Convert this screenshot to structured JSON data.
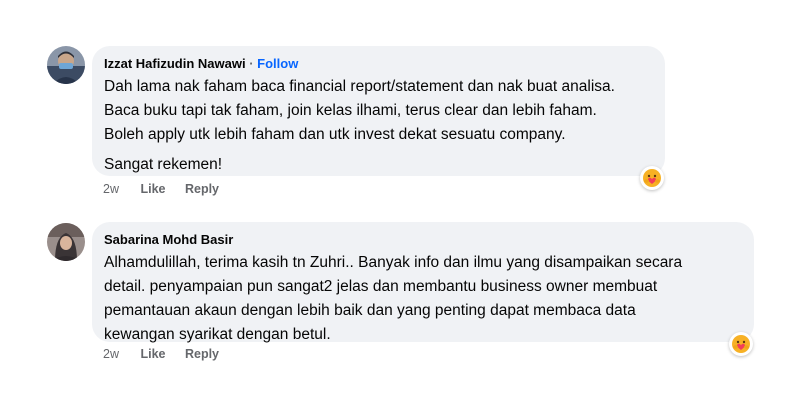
{
  "comments": [
    {
      "author": "Izzat Hafizudin Nawawi",
      "separator": "·",
      "follow_label": "Follow",
      "paragraphs": [
        [
          "Dah lama nak faham baca financial report/statement dan nak buat analisa.",
          "Baca buku tapi tak faham, join kelas ilhami, terus clear dan lebih faham.",
          "Boleh apply utk lebih faham dan utk invest dekat sesuatu company."
        ],
        [
          "Sangat rekemen!"
        ]
      ],
      "reaction_icon": "care-emoji-icon",
      "time": "2w",
      "like_label": "Like",
      "reply_label": "Reply"
    },
    {
      "author": "Sabarina Mohd Basir",
      "paragraphs": [
        [
          "Alhamdulillah, terima kasih tn Zuhri.. Banyak info dan ilmu yang disampaikan secara",
          "detail. penyampaian pun sangat2 jelas dan membantu business owner membuat",
          "pemantauan akaun dengan lebih baik dan yang penting dapat membaca data",
          "kewangan syarikat dengan betul."
        ]
      ],
      "reaction_icon": "care-emoji-icon",
      "time": "2w",
      "like_label": "Like",
      "reply_label": "Reply"
    }
  ],
  "colors": {
    "bubble": "#f0f2f5",
    "text": "#050505",
    "meta": "#65676b",
    "follow": "#0866ff",
    "reaction": "#f7b125"
  }
}
